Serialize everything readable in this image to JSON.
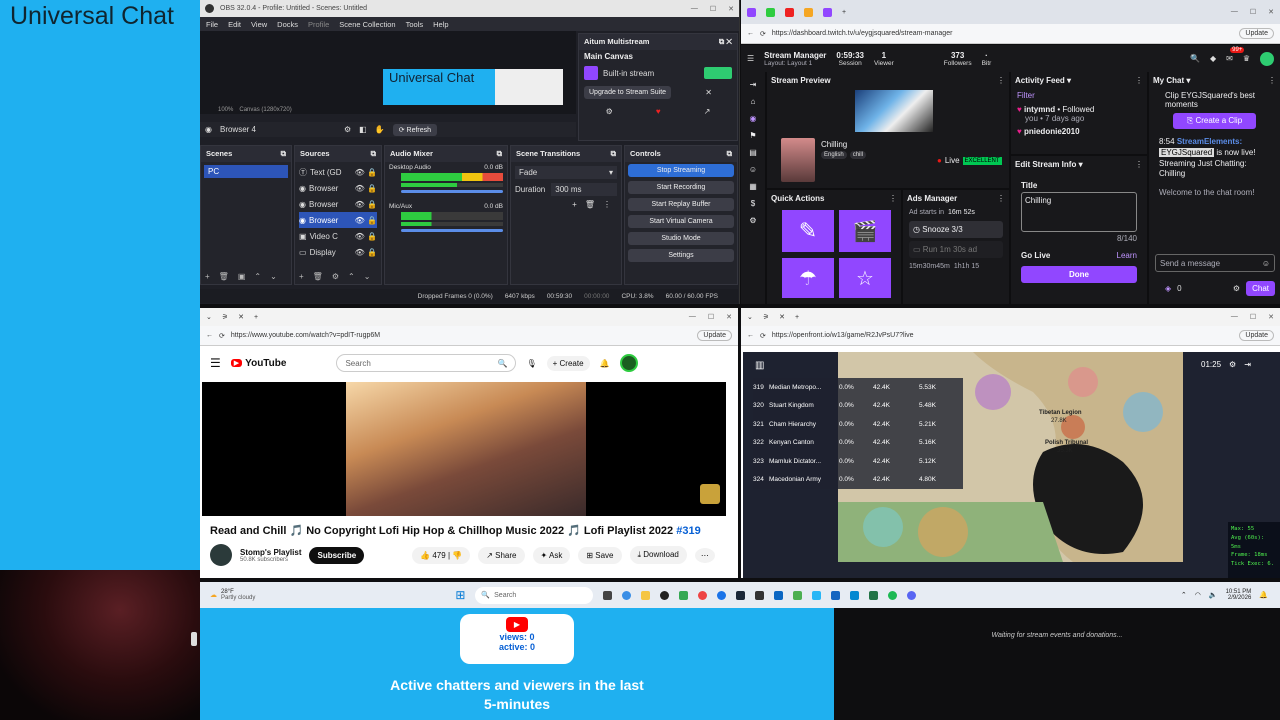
{
  "overlay": {
    "title": "Universal Chat",
    "chatters": {
      "views": "views: 0",
      "active": "active: 0",
      "caption_line1": "Active chatters and viewers in the last",
      "caption_line2": "5-minutes"
    },
    "events_waiting": "Waiting for stream events and donations..."
  },
  "obs": {
    "window_title": "OBS 32.0.4 - Profile: Untitled - Scenes: Untitled",
    "menu": [
      "File",
      "Edit",
      "View",
      "Docks",
      "Profile",
      "Scene Collection",
      "Tools",
      "Help"
    ],
    "preview_title": "Universal Chat",
    "zoom": "100%",
    "canvas": "Canvas (1280x720)",
    "source_name": "Browser 4",
    "refresh_label": "Refresh",
    "multistream": {
      "title": "Aitum Multistream",
      "main_canvas": "Main Canvas",
      "builtin": "Built-in stream",
      "upgrade": "Upgrade to Stream Suite"
    },
    "docks": {
      "scenes": "Scenes",
      "sources": "Sources",
      "audio_mixer": "Audio Mixer",
      "scene_transitions": "Scene Transitions",
      "controls": "Controls"
    },
    "scenes": [
      "PC"
    ],
    "sources": [
      "Text (GD",
      "Browser",
      "Browser",
      "Browser",
      "Video C",
      "Display"
    ],
    "audio": [
      {
        "name": "Desktop Audio",
        "db": "0.0 dB"
      },
      {
        "name": "Mic/Aux",
        "db": "0.0 dB"
      }
    ],
    "transition": {
      "type": "Fade",
      "duration_label": "Duration",
      "duration": "300 ms"
    },
    "controls": [
      "Stop Streaming",
      "Start Recording",
      "Start Replay Buffer",
      "Start Virtual Camera",
      "Studio Mode",
      "Settings"
    ],
    "status": {
      "dropped": "Dropped Frames 0 (0.0%)",
      "kbps": "6407 kbps",
      "stream_time": "00:59:30",
      "rec_time": "00:00:00",
      "cpu": "CPU: 3.8%",
      "fps": "60.00 / 60.00 FPS"
    }
  },
  "twitch": {
    "url": "https://dashboard.twitch.tv/u/eygjsquared/stream-manager",
    "update": "Update",
    "app": "Stream Manager",
    "layout": "Layout: Layout 1",
    "session_time": "0:59:33",
    "session_label": "Session",
    "viewers": "1",
    "viewers_label": "Viewer",
    "followers": "373",
    "followers_label": "Followers",
    "bitrate_label": "Bitr",
    "badge": "99+",
    "stream_preview": "Stream Preview",
    "category": "Chilling",
    "lang": "English",
    "tag": "chill",
    "live": "Live",
    "quality": "EXCELLENT",
    "quick_actions": "Quick Actions",
    "ads_manager": "Ads Manager",
    "ad_starts": "Ad starts in",
    "ad_time": "16m 52s",
    "snooze": "Snooze 3/3",
    "run_ad": "Run 1m 30s ad",
    "ads_footer1": "15m30m45m",
    "ads_footer2": "1h1h 15",
    "activity_feed": "Activity Feed",
    "filter": "Filter",
    "feed_user": "intymnd",
    "feed_action": " • Followed",
    "feed_time": "you • 7 days ago",
    "feed_user2": "pniedonie2010",
    "edit_info": "Edit Stream Info",
    "title_label": "Title",
    "title_value": "Chilling",
    "title_count": "8/140",
    "go_live": "Go Live",
    "learn": "Learn",
    "done": "Done",
    "my_chat": "My Chat",
    "clip_text": "Clip EYGJSquared's best moments",
    "create_clip": "Create a Clip",
    "chat_time": "8:54",
    "chat_user": "StreamElements:",
    "chat_mention": "EYGJSquared",
    "chat_msg1": " is now live! Streaming Just Chatting: Chilling",
    "welcome": "Welcome to the chat room!",
    "send_placeholder": "Send a message",
    "points": "0",
    "chat_btn": "Chat"
  },
  "youtube": {
    "url": "https://www.youtube.com/watch?v=pdIT-rugp6M",
    "update": "Update",
    "brand": "YouTube",
    "search_placeholder": "Search",
    "create": "Create",
    "video_title": "Read and Chill 🎵 No Copyright Lofi Hip Hop & Chillhop Music 2022 🎵 Lofi Playlist 2022",
    "video_tag": "#319",
    "channel": "Stomp's Playlist",
    "subs": "50.8K subscribers",
    "subscribe": "Subscribe",
    "likes": "479",
    "share": "Share",
    "ask": "Ask",
    "save": "Save",
    "download": "Download"
  },
  "openfront": {
    "url": "https://openfront.io/w13/game/R2JvPsU7?live",
    "update": "Update",
    "timer": "01:25",
    "rows": [
      {
        "rank": "319",
        "name": "Median Metropo...",
        "pct": "0.0%",
        "troops": "42.4K",
        "gold": "5.53K"
      },
      {
        "rank": "320",
        "name": "Stuart Kingdom",
        "pct": "0.0%",
        "troops": "42.4K",
        "gold": "5.48K"
      },
      {
        "rank": "321",
        "name": "Cham Hierarchy",
        "pct": "0.0%",
        "troops": "42.4K",
        "gold": "5.21K"
      },
      {
        "rank": "322",
        "name": "Kenyan Canton",
        "pct": "0.0%",
        "troops": "42.4K",
        "gold": "5.16K"
      },
      {
        "rank": "323",
        "name": "Mamluk Dictator...",
        "pct": "0.0%",
        "troops": "42.4K",
        "gold": "5.12K"
      },
      {
        "rank": "324",
        "name": "Macedonian Army",
        "pct": "0.0%",
        "troops": "42.4K",
        "gold": "4.80K"
      }
    ],
    "map_labels": [
      {
        "text": "Tibetan Legion"
      },
      {
        "text": "27.8K"
      },
      {
        "text": "Polish Tribunal"
      },
      {
        "text": "35.3K"
      }
    ],
    "perf": [
      "Frame: 18ms",
      "Avg (60s): 5ms",
      "Tick Exec: 6."
    ],
    "perf_head": "Max: 55"
  },
  "taskbar": {
    "weather_temp": "28°F",
    "weather_desc": "Partly cloudy",
    "search": "Search",
    "time": "10:51 PM",
    "date": "2/9/2026"
  }
}
